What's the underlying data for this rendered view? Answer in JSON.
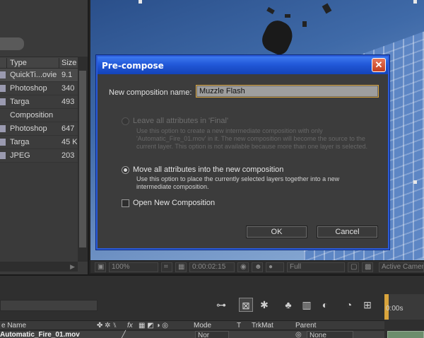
{
  "project_panel": {
    "columns": {
      "type": "Type",
      "size": "Size"
    },
    "rows": [
      {
        "type": "QuickTi...ovie",
        "size": "9.1"
      },
      {
        "type": "Photoshop",
        "size": "340"
      },
      {
        "type": "Targa",
        "size": "493"
      },
      {
        "type": "Composition",
        "size": ""
      },
      {
        "type": "Photoshop",
        "size": "647"
      },
      {
        "type": "Targa",
        "size": "45 K"
      },
      {
        "type": "JPEG",
        "size": "203"
      }
    ]
  },
  "viewer_bar": {
    "zoom": "100%",
    "timecode": "0:00:02:15",
    "resolution": "Full",
    "camera": "Active Camera"
  },
  "dialog": {
    "title": "Pre-compose",
    "close_glyph": "✕",
    "name_label": "New composition name:",
    "name_value": "Muzzle Flash",
    "option_leave": {
      "title": "Leave all attributes in 'Final'",
      "desc": "Use this option to create a new intermediate composition with only 'Automatic_Fire_01.mov' in it. The new composition will become the source to the current layer. This option is not available because more than one layer is selected."
    },
    "option_move": {
      "title": "Move all attributes into the new composition",
      "desc": "Use this option to place the currently selected layers together into a new intermediate composition."
    },
    "open_new": "Open New Composition",
    "ok": "OK",
    "cancel": "Cancel"
  },
  "timeline": {
    "ruler_zero": "0:00s",
    "col_source": "e Name",
    "col_switches": "fx",
    "col_mode": "Mode",
    "col_t": "T",
    "col_trkmat": "TrkMat",
    "col_parent": "Parent",
    "layer_name": "Automatic_Fire_01.mov",
    "layer_mode": "Nor",
    "layer_parent": "None"
  },
  "colors": {
    "dialog_titlebar": "#2158d8",
    "field_highlight": "#d9a43c",
    "timeline_bar": "#6c8d6c"
  }
}
